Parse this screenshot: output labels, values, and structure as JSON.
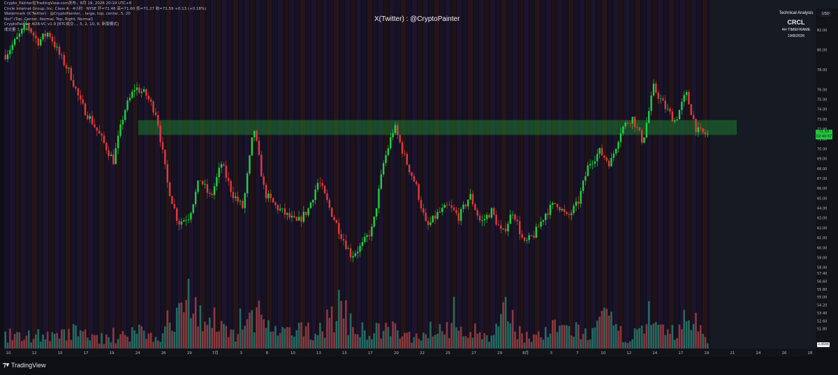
{
  "header": {
    "line1": "Crypto_Painter在TradingView.com发布，8月 19, 2026 20:19 UTC+8",
    "line2": "Circle Internet Group, Inc. Class A · 4小时 · NYSE  开=71.46  高=71.60  低=71.27  收=71.59  +0.13 (+0.18%)",
    "line3": "Watermark (ICTwitter) · @CryptoPainter, , large, top, center, 5, 20",
    "line4": "Not\" (Top, Center, Normal, Top, Right, Normal)",
    "line5": "CryptoPainter ADR-VC v1.9 [BTC成交..., 5, 2, 10, 8, 新版模式]",
    "vol_label": "成交量",
    "vol_value": "3.464K"
  },
  "watermark": "X(Twitter) : @CryptoPainter",
  "info_box": {
    "title": "Technical Analysis",
    "ticker": "CRCL",
    "timeframe": "4H TIMEFRAME",
    "date": "19/8/2026"
  },
  "axis_currency": "USD",
  "price_tag": {
    "price": "71.59",
    "countdown": "02:40:57"
  },
  "volume_tag": "3.464K",
  "brand": "TradingView",
  "colors": {
    "background": "#0e0f14",
    "up": "#1ed33f",
    "down": "#e23a3a",
    "zone": "#1f8f34",
    "stripe_a": "#3a1d63",
    "stripe_b": "#5a2222"
  },
  "chart_data": {
    "type": "candlestick",
    "title": "",
    "ylim": [
      49.8,
      84.2
    ],
    "y_ticks": [
      82.0,
      80.0,
      78.0,
      76.0,
      75.0,
      74.0,
      73.0,
      72.0,
      71.0,
      70.0,
      69.0,
      68.0,
      67.0,
      66.0,
      65.0,
      64.0,
      63.0,
      62.0,
      61.0,
      60.0,
      59.0,
      58.0,
      57.4,
      56.6,
      55.8,
      55.0,
      54.2,
      53.4,
      52.6,
      51.8
    ],
    "x_ticks": [
      "10",
      "12",
      "15",
      "17",
      "19",
      "24",
      "26",
      "29",
      "7月",
      "3",
      "8",
      "10",
      "13",
      "15",
      "17",
      "20",
      "22",
      "25",
      "27",
      "29",
      "8月",
      "5",
      "7",
      "10",
      "12",
      "14",
      "17",
      "19",
      "21",
      "24",
      "26",
      "28"
    ],
    "resistance_zone": [
      71.4,
      72.9
    ],
    "price_path": [
      79.5,
      81.0,
      82.6,
      80.8,
      81.8,
      79.5,
      77.6,
      74.5,
      72.8,
      70.8,
      68.8,
      73.8,
      76.2,
      75.5,
      73.5,
      66.5,
      62.5,
      63.2,
      67.0,
      65.0,
      68.5,
      65.5,
      64.0,
      72.2,
      65.5,
      64.2,
      63.3,
      62.5,
      63.8,
      66.8,
      64.0,
      61.5,
      59.2,
      60.2,
      62.0,
      68.5,
      72.3,
      69.0,
      66.3,
      62.0,
      63.4,
      64.2,
      63.1,
      65.3,
      62.5,
      63.7,
      61.3,
      63.8,
      60.3,
      61.4,
      63.5,
      64.6,
      63.0,
      64.5,
      68.5,
      69.7,
      68.5,
      72.0,
      73.2,
      70.7,
      76.2,
      74.3,
      72.8,
      75.6,
      71.8,
      71.4
    ],
    "volume": {
      "values": [
        3.4,
        2.8,
        3.6,
        2.6,
        4.2,
        3.1,
        2.3,
        3.0,
        4.9,
        2.7,
        5.0,
        13.9,
        5.6,
        4.4,
        3.1,
        9.5,
        3.7,
        3.8,
        4.6,
        4.9,
        10.6,
        4.3,
        4.2,
        4.7,
        3.0,
        3.6,
        5.8,
        3.8,
        4.3,
        2.1,
        9.1,
        3.1,
        3.1,
        5.2,
        4.7,
        3.3,
        7.5,
        2.8,
        4.1,
        4.6,
        3.8,
        8.6,
        1.2
      ]
    }
  }
}
